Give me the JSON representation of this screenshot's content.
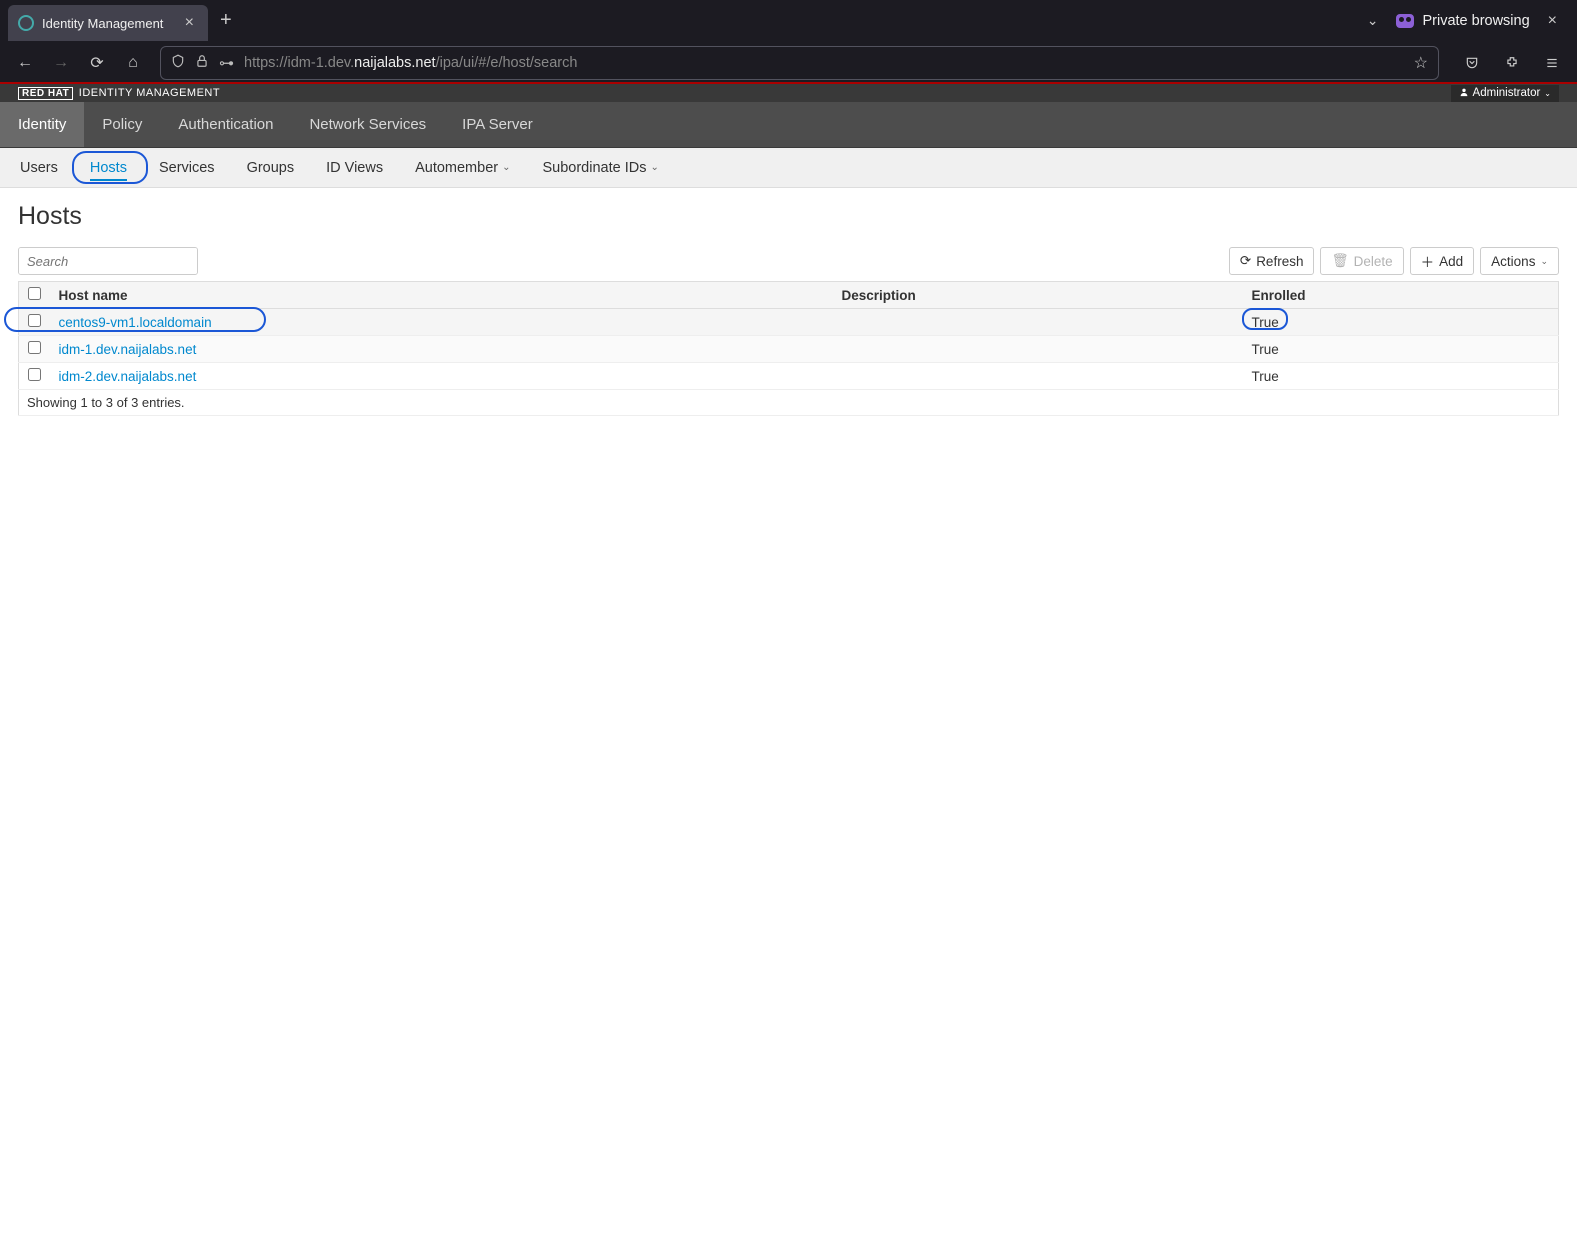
{
  "browser": {
    "tab_title": "Identity Management",
    "private_label": "Private browsing",
    "url_prefix": "https://idm-1.dev.",
    "url_bold": "naijalabs.net",
    "url_suffix": "/ipa/ui/#/e/host/search"
  },
  "brand": {
    "redhat": "RED HAT",
    "product": "IDENTITY MANAGEMENT"
  },
  "user_menu": "Administrator",
  "main_nav": [
    "Identity",
    "Policy",
    "Authentication",
    "Network Services",
    "IPA Server"
  ],
  "main_nav_active": 0,
  "sub_nav": [
    {
      "label": "Users"
    },
    {
      "label": "Hosts"
    },
    {
      "label": "Services"
    },
    {
      "label": "Groups"
    },
    {
      "label": "ID Views"
    },
    {
      "label": "Automember",
      "dropdown": true
    },
    {
      "label": "Subordinate IDs",
      "dropdown": true
    }
  ],
  "sub_nav_active": 1,
  "page_title": "Hosts",
  "search_placeholder": "Search",
  "buttons": {
    "refresh": "Refresh",
    "delete": "Delete",
    "add": "Add",
    "actions": "Actions"
  },
  "table": {
    "headers": {
      "host": "Host name",
      "desc": "Description",
      "enrolled": "Enrolled"
    },
    "rows": [
      {
        "host": "centos9-vm1.localdomain",
        "desc": "",
        "enrolled": "True"
      },
      {
        "host": "idm-1.dev.naijalabs.net",
        "desc": "",
        "enrolled": "True"
      },
      {
        "host": "idm-2.dev.naijalabs.net",
        "desc": "",
        "enrolled": "True"
      }
    ],
    "footer": "Showing 1 to 3 of 3 entries."
  }
}
